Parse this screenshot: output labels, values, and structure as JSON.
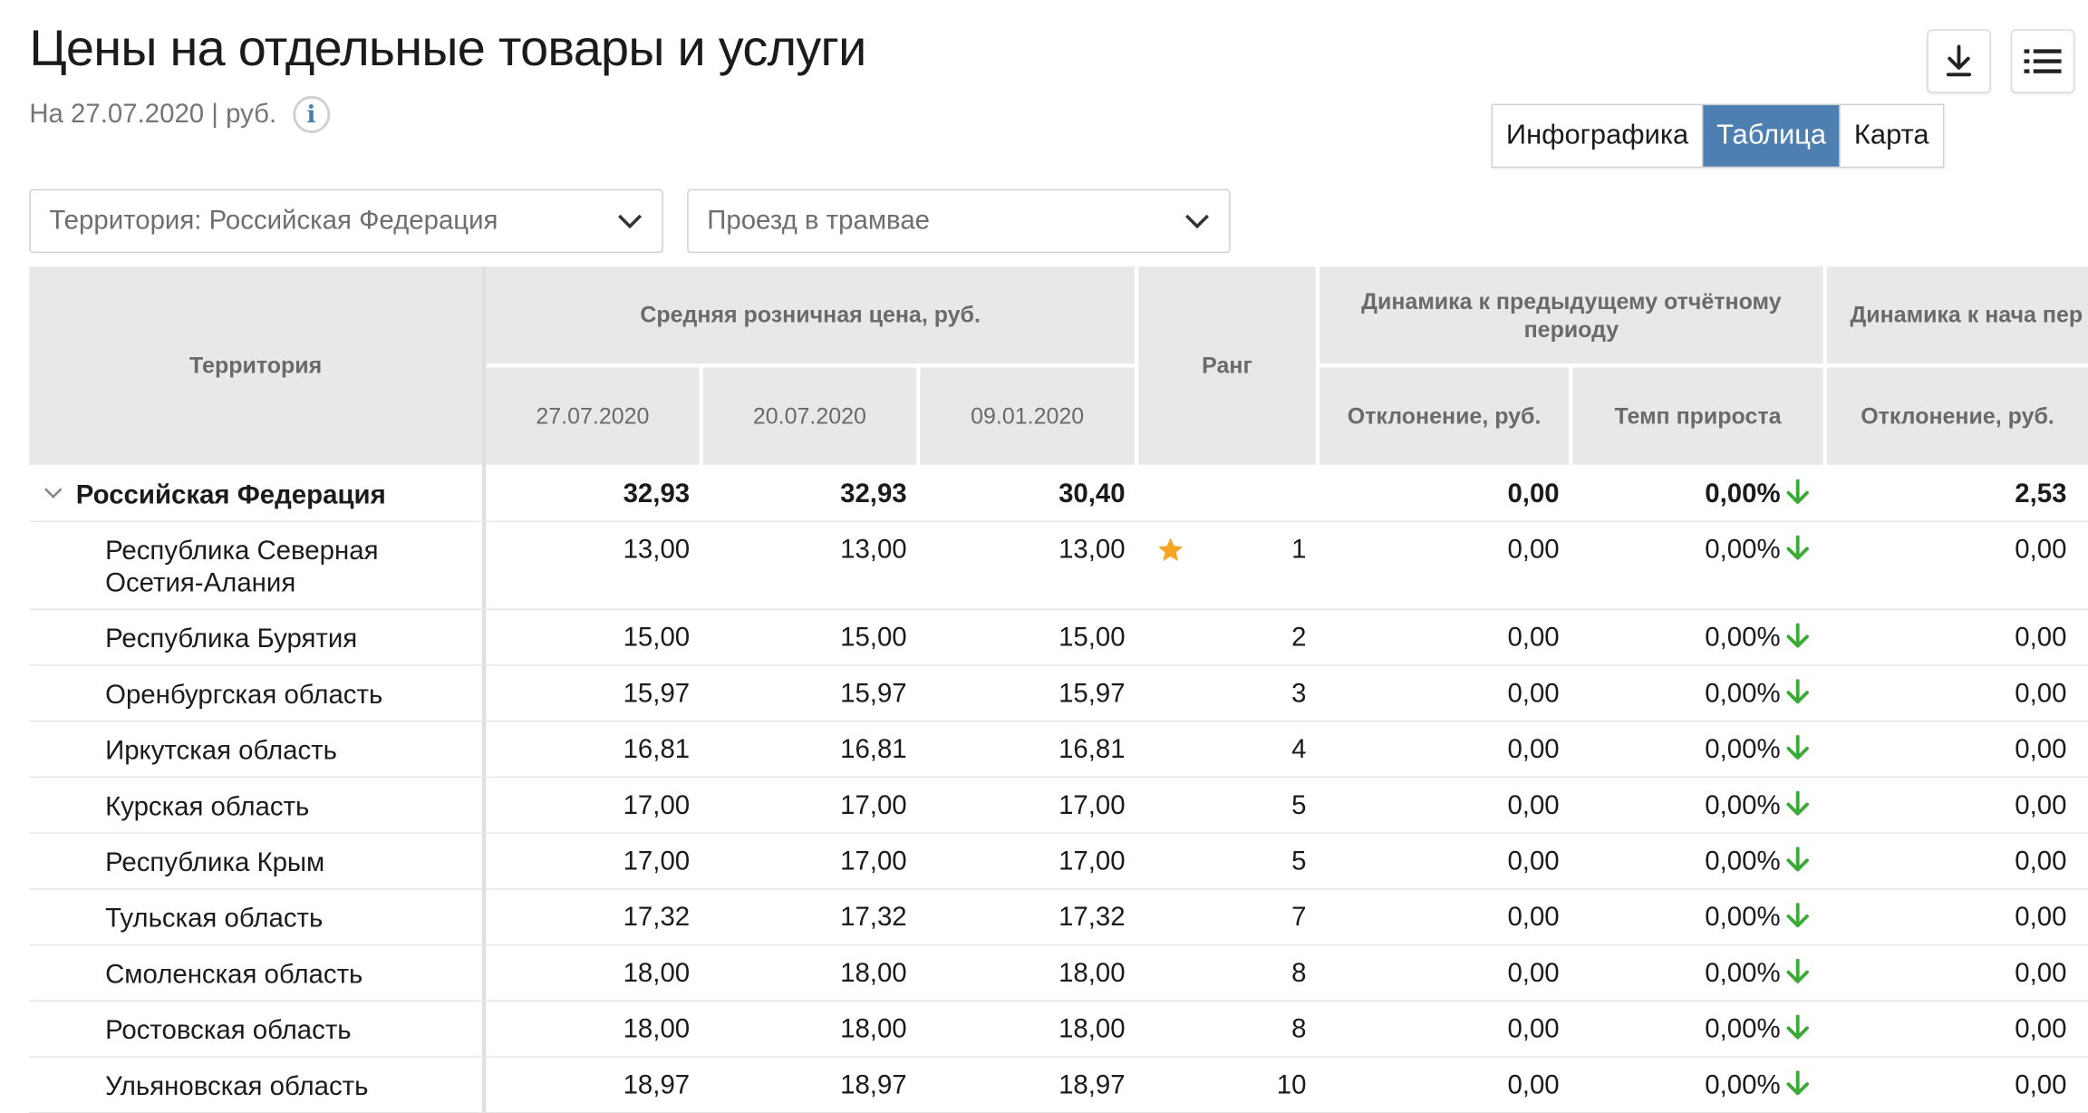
{
  "header": {
    "title": "Цены на отдельные товары и услуги",
    "subtitle": "На 27.07.2020 | руб.",
    "info_icon": "info-icon",
    "download_icon": "download-icon",
    "menu_icon": "list-icon"
  },
  "view_switch": {
    "options": [
      "Инфографика",
      "Таблица",
      "Карта"
    ],
    "active": "Таблица",
    "active_color": "#4d80b0"
  },
  "filters": {
    "territory": "Территория: Российская  Федерация",
    "product": "Проезд в трамвае"
  },
  "table": {
    "headers": {
      "territory": "Территория",
      "avg_price": "Средняя розничная цена, руб.",
      "date1": "27.07.2020",
      "date2": "20.07.2020",
      "date3": "09.01.2020",
      "rank": "Ранг",
      "dyn_prev": "Динамика к предыдущему отчётному периоду",
      "dev_rub": "Отклонение, руб.",
      "growth_rate": "Темп прироста",
      "dyn_start": "Динамика к нача пер",
      "dev_rub2": "Отклонение, руб."
    },
    "total": {
      "name": "Российская Федерация",
      "d1": "32,93",
      "d2": "32,93",
      "d3": "30,40",
      "rank": "",
      "dev": "0,00",
      "rate": "0,00%",
      "dev2": "2,53"
    },
    "rows": [
      {
        "name": "Республика Северная Осетия-Алания",
        "d1": "13,00",
        "d2": "13,00",
        "d3": "13,00",
        "rank": "1",
        "dev": "0,00",
        "rate": "0,00%",
        "dev2": "0,00"
      },
      {
        "name": "Республика Бурятия",
        "d1": "15,00",
        "d2": "15,00",
        "d3": "15,00",
        "rank": "2",
        "dev": "0,00",
        "rate": "0,00%",
        "dev2": "0,00"
      },
      {
        "name": "Оренбургская область",
        "d1": "15,97",
        "d2": "15,97",
        "d3": "15,97",
        "rank": "3",
        "dev": "0,00",
        "rate": "0,00%",
        "dev2": "0,00"
      },
      {
        "name": "Иркутская область",
        "d1": "16,81",
        "d2": "16,81",
        "d3": "16,81",
        "rank": "4",
        "dev": "0,00",
        "rate": "0,00%",
        "dev2": "0,00"
      },
      {
        "name": "Курская область",
        "d1": "17,00",
        "d2": "17,00",
        "d3": "17,00",
        "rank": "5",
        "dev": "0,00",
        "rate": "0,00%",
        "dev2": "0,00"
      },
      {
        "name": "Республика Крым",
        "d1": "17,00",
        "d2": "17,00",
        "d3": "17,00",
        "rank": "5",
        "dev": "0,00",
        "rate": "0,00%",
        "dev2": "0,00"
      },
      {
        "name": "Тульская область",
        "d1": "17,32",
        "d2": "17,32",
        "d3": "17,32",
        "rank": "7",
        "dev": "0,00",
        "rate": "0,00%",
        "dev2": "0,00"
      },
      {
        "name": "Смоленская область",
        "d1": "18,00",
        "d2": "18,00",
        "d3": "18,00",
        "rank": "8",
        "dev": "0,00",
        "rate": "0,00%",
        "dev2": "0,00"
      },
      {
        "name": "Ростовская область",
        "d1": "18,00",
        "d2": "18,00",
        "d3": "18,00",
        "rank": "8",
        "dev": "0,00",
        "rate": "0,00%",
        "dev2": "0,00"
      },
      {
        "name": "Ульяновская область",
        "d1": "18,97",
        "d2": "18,97",
        "d3": "18,97",
        "rank": "10",
        "dev": "0,00",
        "rate": "0,00%",
        "dev2": "0,00"
      }
    ],
    "star_icon": "star-icon",
    "arrow_icon": "arrow-down-icon",
    "arrow_color": "#3aa935",
    "star_color": "#f5a623"
  }
}
